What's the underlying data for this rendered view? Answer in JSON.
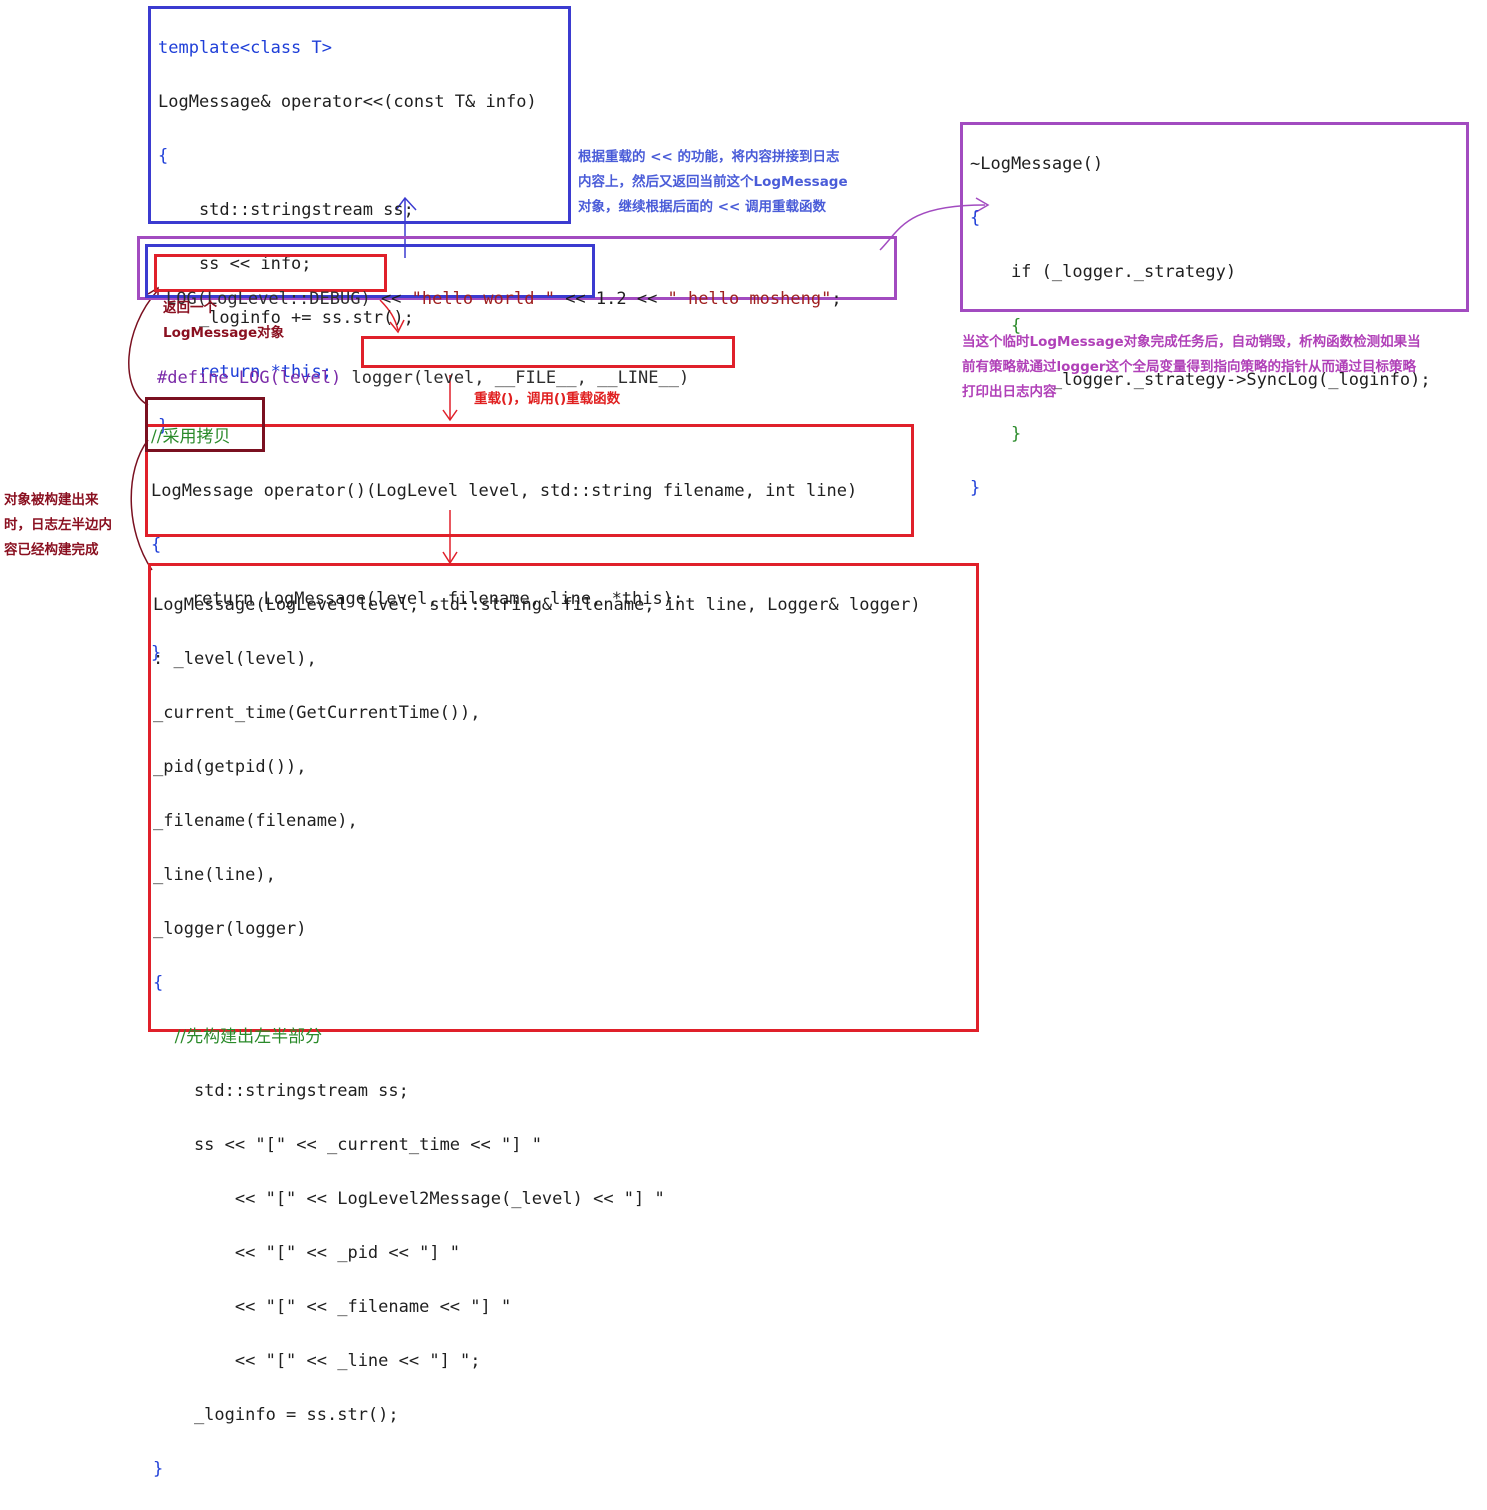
{
  "operator_block": {
    "lines": [
      "template<class T>",
      "LogMessage& operator<<(const T& info)",
      "{",
      "    std::stringstream ss;",
      "    ss << info;",
      "    _loginfo += ss.str();",
      "    return *this;",
      "}"
    ]
  },
  "log_call": {
    "log_part": "LOG(LogLevel::DEBUG)",
    "rest_a": " << ",
    "hello": "\"hello world \"",
    "rest_b": " << 1.2 << ",
    "mosheng": "\" hello mosheng\"",
    "end": ";"
  },
  "define_line": {
    "prefix": "#define LOG(level) ",
    "body": "logger(level, __FILE__, __LINE__)"
  },
  "functor_block": {
    "comment": "//采用拷贝",
    "type": "LogMessage",
    "signature": " operator()(LogLevel level, std::string filename, int line)",
    "open": "{",
    "body": "    return LogMessage(level, filename, line, *this);",
    "close": "}"
  },
  "ctor_block": {
    "lines": [
      "LogMessage(LogLevel level, std::string& filename, int line, Logger& logger)",
      ": _level(level),",
      "_current_time(GetCurrentTime()),",
      "_pid(getpid()),",
      "_filename(filename),",
      "_line(line),",
      "_logger(logger)",
      "{",
      "    //先构建出左半部分",
      "    std::stringstream ss;",
      "    ss << \"[\" << _current_time << \"] \"",
      "        << \"[\" << LogLevel2Message(_level) << \"] \"",
      "        << \"[\" << _pid << \"] \"",
      "        << \"[\" << _filename << \"] \"",
      "        << \"[\" << _line << \"] \";",
      "    _loginfo = ss.str();",
      "}"
    ]
  },
  "dtor_block": {
    "lines": [
      "~LogMessage()",
      "{",
      "    if (_logger._strategy)",
      "    {",
      "        _logger._strategy->SyncLog(_loginfo);",
      "    }",
      "}"
    ]
  },
  "notes": {
    "operator_note": [
      "根据重载的 << 的功能，将内容拼接到日志",
      "内容上，然后又返回当前这个LogMessage",
      "对象，继续根据后面的 << 调用重载函数"
    ],
    "return_note": [
      "返回一个",
      "LogMessage对象"
    ],
    "overload_note": "重载()，调用()重载函数",
    "left_note": [
      "对象被构建出来",
      "时，日志左半边内",
      "容已经构建完成"
    ],
    "dtor_note": [
      "当这个临时LogMessage对象完成任务后，自动销毁，析构函数检测如果当",
      "前有策略就通过logger这个全局变量得到指向策略的指针从而通过目标策略",
      "打印出日志内容"
    ]
  },
  "colors": {
    "blue": "#3b3bd0",
    "purple": "#a24bc0",
    "red": "#e0202a",
    "darkred": "#7a1020"
  }
}
